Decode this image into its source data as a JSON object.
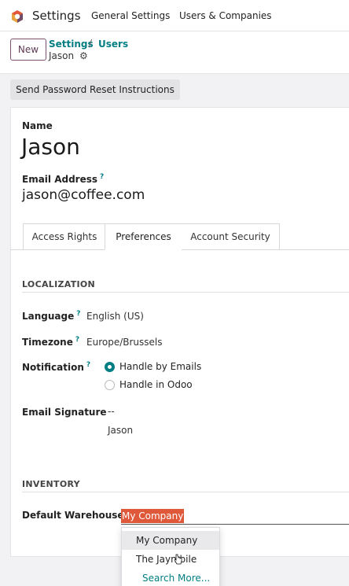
{
  "topbar": {
    "app_title": "Settings",
    "menu": [
      "General Settings",
      "Users & Companies"
    ],
    "logo_icon": "odoo-app-logo"
  },
  "controlbar": {
    "new_label": "New",
    "breadcrumb": [
      "Settings",
      "Users"
    ],
    "separator": "/",
    "record_name": "Jason",
    "gear_icon": "gear-icon"
  },
  "actions": {
    "reset_password": "Send Password Reset Instructions"
  },
  "form": {
    "name_label": "Name",
    "name_value": "Jason",
    "email_label": "Email Address",
    "email_help": "?",
    "email_value": "jason@coffee.com"
  },
  "tabs": [
    "Access Rights",
    "Preferences",
    "Account Security"
  ],
  "active_tab": "Preferences",
  "localization": {
    "heading": "LOCALIZATION",
    "language_label": "Language",
    "language_value": "English (US)",
    "timezone_label": "Timezone",
    "timezone_value": "Europe/Brussels",
    "notification_label": "Notification",
    "notification_options": [
      "Handle by Emails",
      "Handle in Odoo"
    ],
    "notification_selected": "Handle by Emails",
    "help": "?",
    "signature_label": "Email Signature",
    "signature_lines": [
      "--",
      "Jason"
    ]
  },
  "inventory": {
    "heading": "INVENTORY",
    "warehouse_label": "Default Warehouse",
    "warehouse_value": "My Company",
    "dropdown_options": [
      "My Company",
      "The Jayn bile",
      "Search More..."
    ]
  },
  "colors": {
    "brand": "#714b67",
    "accent": "#017e84",
    "selection": "#e0583a"
  }
}
